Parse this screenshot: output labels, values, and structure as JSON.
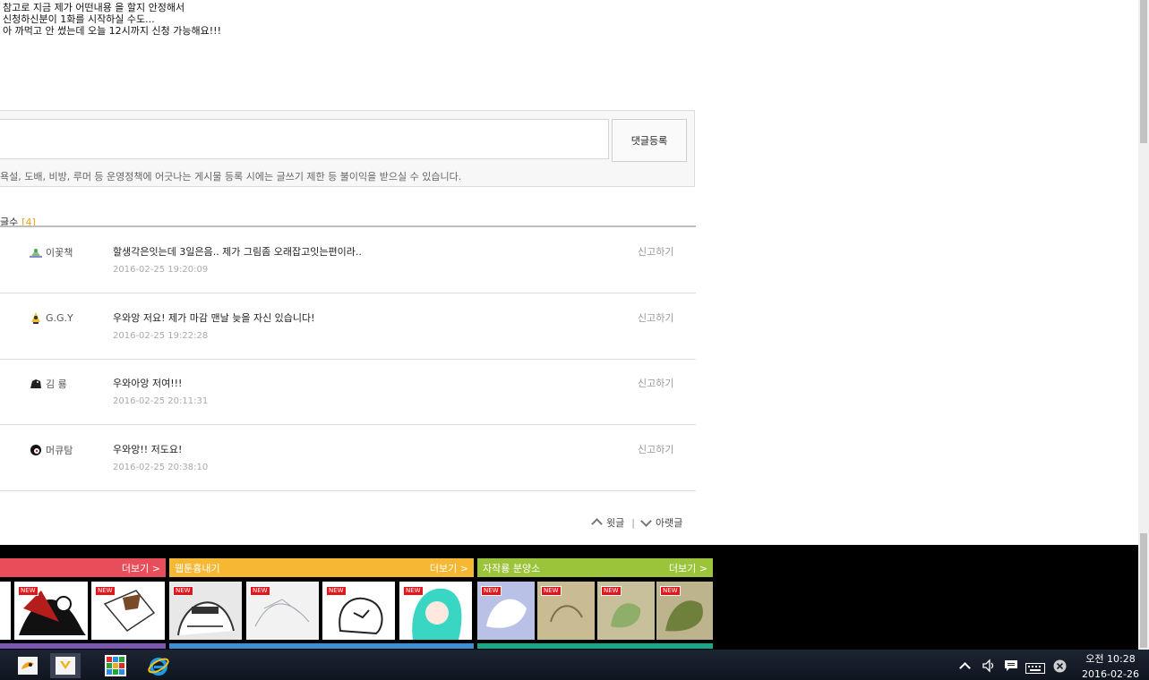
{
  "post": {
    "lines": [
      "참고로 지금 제가 어떤내용 을 할지 안정해서",
      "신청하신분이 1화를 시작하실 수도...",
      "아 까먹고 안 썼는데 오늘 12시까지  신청 가능해요!!!"
    ]
  },
  "comment_form": {
    "input_value": "",
    "submit_label": "댓글등록",
    "notice": "욕설, 도배, 비방, 루머 등 운영정책에 어긋나는 게시물 등록 시에는 글쓰기 제한 등 불이익을 받으실 수 있습니다."
  },
  "comments": {
    "count_label": "글수",
    "count_value": "[4]",
    "report_label": "신고하기",
    "items": [
      {
        "nick": "이꽃책",
        "icon": "flower-icon",
        "text": "할생각은잇는데 3일은음.. 제가 그림좀 오래잡고잇는편이라..",
        "date": "2016-02-25 19:20:09"
      },
      {
        "nick": "G.G.Y",
        "icon": "character-icon",
        "text": "우와앙 저요! 제가 마감 맨날 늦을 자신 있습니다!",
        "date": "2016-02-25 19:22:28"
      },
      {
        "nick": "김 룡",
        "icon": "dragon-icon",
        "text": "우와아앙 저여!!!",
        "date": "2016-02-25 20:11:31"
      },
      {
        "nick": "머큐탐",
        "icon": "face-icon",
        "text": "우와앙!! 저도요!",
        "date": "2016-02-25 20:38:10"
      }
    ],
    "prev_label": "윗글",
    "next_label": "아랫글"
  },
  "footer": {
    "categories": [
      {
        "title": "",
        "more": "더보기 >",
        "color": "#e84e5a"
      },
      {
        "title": "웹툰흉내기",
        "more": "더보기 >",
        "color": "#f6b732"
      },
      {
        "title": "자작룡 분양소",
        "more": "더보기 >",
        "color": "#9cc43a"
      }
    ],
    "new_badge": "NEW",
    "under_colors": [
      "#7c58b5",
      "#3c8fd6",
      "#19a78a"
    ]
  },
  "taskbar": {
    "time": "오전 10:28",
    "date": "2016-02-26"
  }
}
